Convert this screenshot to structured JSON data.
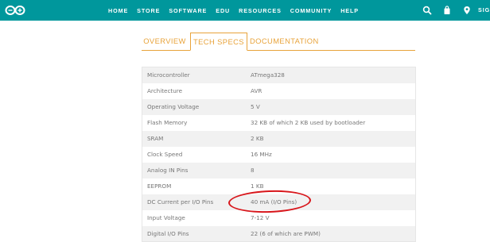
{
  "header": {
    "logo_icon": "arduino-infinity-logo-icon",
    "nav": [
      "HOME",
      "STORE",
      "SOFTWARE",
      "EDU",
      "RESOURCES",
      "COMMUNITY",
      "HELP"
    ],
    "icons": [
      "search-icon",
      "cart-icon",
      "location-pin-icon"
    ],
    "signin_partial": "SIG",
    "colors": {
      "bar": "#00979c",
      "text": "#ffffff"
    }
  },
  "tabs": {
    "overview": "OVERVIEW",
    "tech_specs": "TECH SPECS",
    "documentation": "DOCUMENTATION",
    "active": "TECH SPECS",
    "accent_color": "#e8a33a"
  },
  "specs": [
    {
      "label": "Microcontroller",
      "value": "ATmega328"
    },
    {
      "label": "Architecture",
      "value": "AVR"
    },
    {
      "label": "Operating Voltage",
      "value": "5 V"
    },
    {
      "label": "Flash Memory",
      "value": "32 KB of which 2 KB used by bootloader"
    },
    {
      "label": "SRAM",
      "value": "2 KB"
    },
    {
      "label": "Clock Speed",
      "value": "16 MHz"
    },
    {
      "label": "Analog IN Pins",
      "value": "8"
    },
    {
      "label": "EEPROM",
      "value": "1 KB"
    },
    {
      "label": "DC Current per I/O Pins",
      "value": "40 mA (I/O Pins)"
    },
    {
      "label": "Input Voltage",
      "value": "7-12 V"
    },
    {
      "label": "Digital I/O Pins",
      "value": "22 (6 of which are PWM)"
    }
  ],
  "annotation": {
    "highlighted_row": "DC Current per I/O Pins",
    "color": "#d8161b"
  }
}
